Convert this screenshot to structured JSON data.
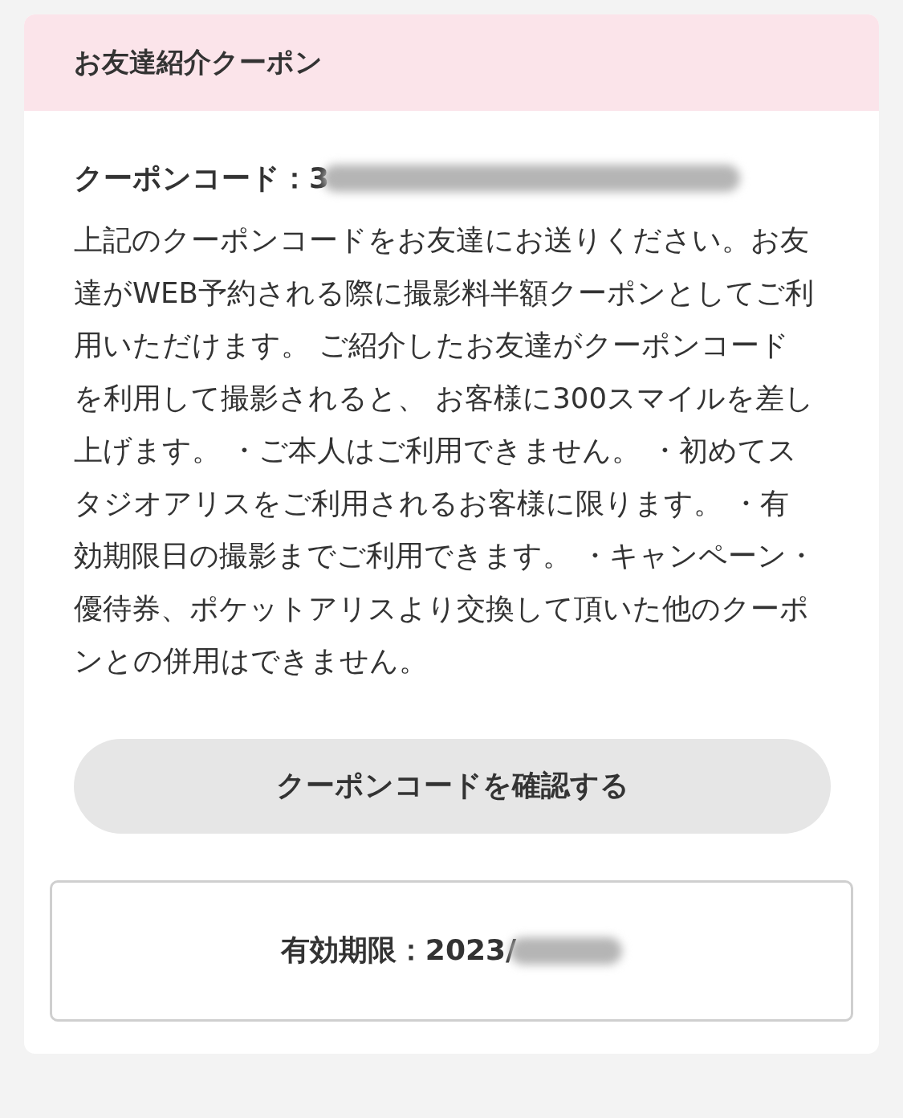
{
  "card": {
    "title": "お友達紹介クーポン",
    "coupon_code": "クーポンコード：3",
    "description": "上記のクーポンコードをお友達にお送りください。お友達がWEB予約される際に撮影料半額クーポンとしてご利用いただけます。 ご紹介したお友達がクーポンコードを利用して撮影されると、 お客様に300スマイルを差し上げます。 ・ご本人はご利用できません。 ・初めてスタジオアリスをご利用されるお客様に限ります。 ・有効期限日の撮影までご利用できます。 ・キャンペーン・優待券、ポケットアリスより交換して頂いた他のクーポンとの併用はできません。",
    "button": "クーポンコードを確認する",
    "expiry": "有効期限：2023/"
  }
}
